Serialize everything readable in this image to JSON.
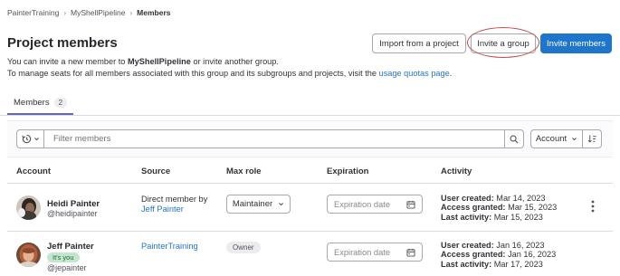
{
  "breadcrumb": {
    "items": [
      "PainterTraining",
      "MyShellPipeline",
      "Members"
    ],
    "separator": "›"
  },
  "header": {
    "title": "Project members",
    "desc_line1_pre": "You can invite a new member to ",
    "desc_line1_project": "MyShellPipeline",
    "desc_line1_post": " or invite another group.",
    "desc_line2_pre": "To manage seats for all members associated with this group and its subgroups and projects, visit the ",
    "desc_line2_link": "usage quotas page",
    "desc_line2_post": "."
  },
  "actions": {
    "import_label": "Import from a project",
    "invite_group_label": "Invite a group",
    "invite_members_label": "Invite members"
  },
  "tabs": [
    {
      "label": "Members",
      "count": "2"
    }
  ],
  "filter": {
    "placeholder": "Filter members",
    "sort_label": "Account"
  },
  "table": {
    "headers": {
      "account": "Account",
      "source": "Source",
      "max_role": "Max role",
      "expiration": "Expiration",
      "activity": "Activity"
    },
    "rows": [
      {
        "name": "Heidi Painter",
        "handle": "@heidipainter",
        "source_text": "Direct member by",
        "source_link": "Jeff Painter",
        "role": "Maintainer",
        "expiration_placeholder": "Expiration date",
        "user_created_label": "User created:",
        "user_created": "Mar 14, 2023",
        "access_granted_label": "Access granted:",
        "access_granted": "Mar 15, 2023",
        "last_activity_label": "Last activity:",
        "last_activity": "Mar 15, 2023"
      },
      {
        "name": "Jeff Painter",
        "you_badge": "It's you",
        "handle": "@jepainter",
        "source_link": "PainterTraining",
        "role": "Owner",
        "expiration_placeholder": "Expiration date",
        "user_created_label": "User created:",
        "user_created": "Jan 16, 2023",
        "access_granted_label": "Access granted:",
        "access_granted": "Jan 16, 2023",
        "last_activity_label": "Last activity:",
        "last_activity": "Mar 17, 2023"
      }
    ]
  },
  "icons": [
    "history-icon",
    "chevron-down-icon",
    "search-icon",
    "sort-icon",
    "calendar-icon",
    "kebab-icon"
  ],
  "colors": {
    "primary": "#1f75cb",
    "link": "#1f75cb",
    "tab_underline": "#6666c4",
    "highlight_circle": "#c94c4c",
    "you_badge_bg": "#c3e6cd"
  }
}
